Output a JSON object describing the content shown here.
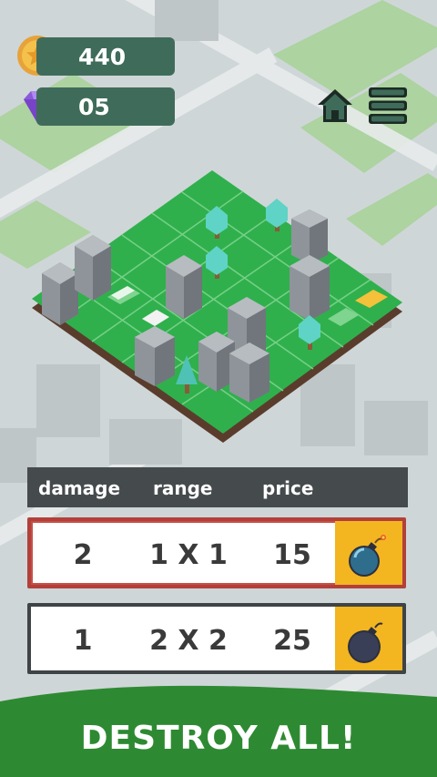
{
  "hud": {
    "coins": "440",
    "gems": "05",
    "coin_icon": "coin-star-icon",
    "gem_icon": "diamond-icon",
    "home_icon": "home-icon",
    "menu_icon": "menu-icon"
  },
  "table": {
    "headers": {
      "damage": "damage",
      "range": "range",
      "price": "price"
    },
    "rows": [
      {
        "damage": "2",
        "range": "1 X 1",
        "price": "15",
        "icon": "bomb-lit-icon",
        "selected": true
      },
      {
        "damage": "1",
        "range": "2 X 2",
        "price": "25",
        "icon": "bomb-icon",
        "selected": false
      }
    ]
  },
  "banner": {
    "text": "DESTROY ALL!"
  },
  "colors": {
    "pill_bg": "#3f6c5a",
    "grid_green": "#2fb04c",
    "table_header": "#454a4c",
    "bomb_box": "#f3b520",
    "selected_border": "#b2403a",
    "banner_green": "#2e8a32"
  }
}
